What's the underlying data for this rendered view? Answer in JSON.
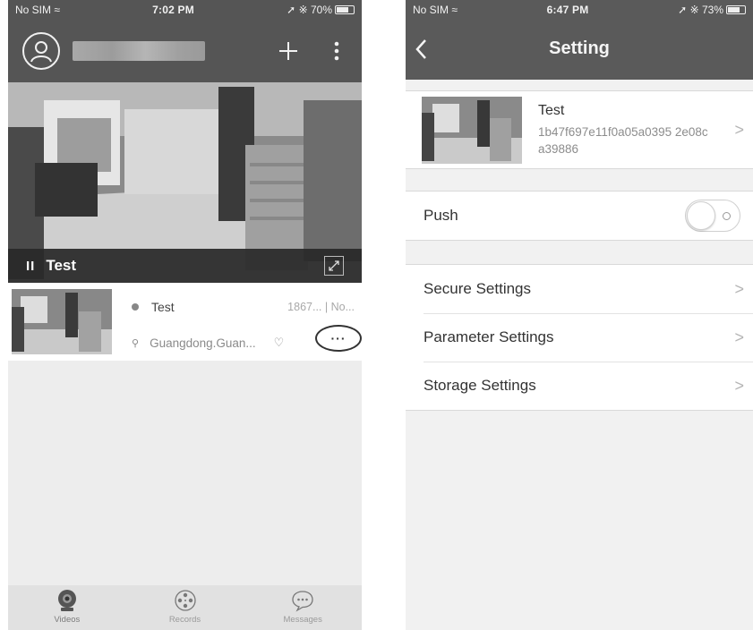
{
  "left": {
    "status": {
      "carrier": "No SIM",
      "time": "7:02 PM",
      "battery_text": "70%",
      "battery_level": 0.7
    },
    "header": {
      "add_icon": "plus-icon",
      "more_icon": "vertical-dots-icon",
      "avatar_icon": "user-icon"
    },
    "video": {
      "title": "Test",
      "pause_label": "II",
      "fullscreen_icon": "expand-icon"
    },
    "camera": {
      "name": "Test",
      "meta": "1867... | No...",
      "location": "Guangdong.Guan...",
      "more_label": "···"
    },
    "tabs": [
      {
        "label": "Videos",
        "icon": "webcam-icon",
        "active": true
      },
      {
        "label": "Records",
        "icon": "film-reel-icon",
        "active": false
      },
      {
        "label": "Messages",
        "icon": "chat-bubble-icon",
        "active": false
      }
    ]
  },
  "right": {
    "status": {
      "carrier": "No SIM",
      "time": "6:47 PM",
      "battery_text": "73%",
      "battery_level": 0.73
    },
    "nav": {
      "title": "Setting",
      "back_icon": "chevron-left-icon"
    },
    "device": {
      "name": "Test",
      "id": "1b47f697e11f0a05a0395 2e08ca39886"
    },
    "push": {
      "label": "Push",
      "enabled": false
    },
    "settings": [
      {
        "label": "Secure Settings"
      },
      {
        "label": "Parameter Settings"
      },
      {
        "label": "Storage Settings"
      }
    ],
    "chevron": ">"
  },
  "colors": {
    "header_left": "#555555",
    "header_right": "#5a5a5a",
    "background": "#ededed",
    "tabbar": "#e1e1e1"
  }
}
